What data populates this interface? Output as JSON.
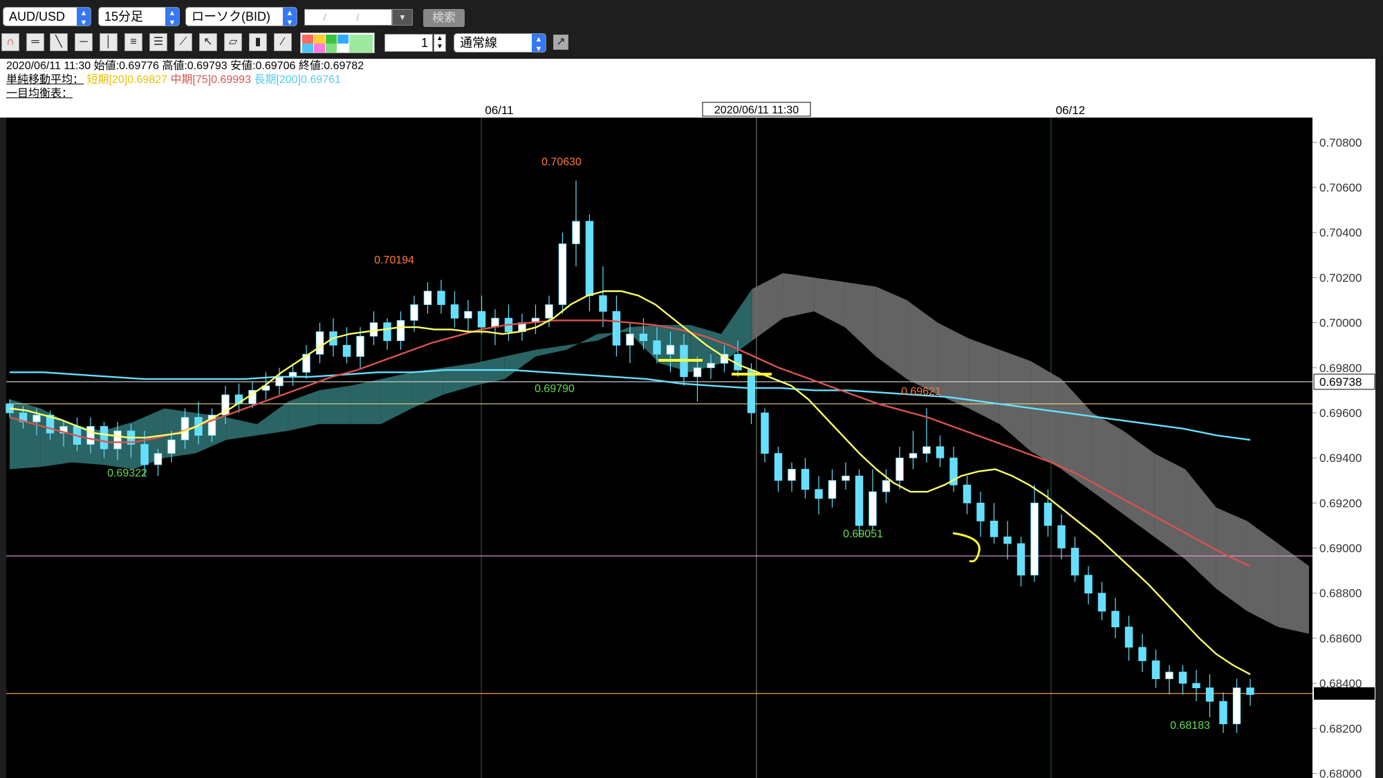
{
  "toolbar": {
    "symbol": "AUD/USD",
    "timeframe": "15分足",
    "chart_type": "ローソク(BID)",
    "date_placeholder": "/ /",
    "search_label": "検索",
    "line_width": "1",
    "line_style": "通常線",
    "palette_colors": [
      "#ff6b5e",
      "#ffcc33",
      "#3ec43e",
      "#33aaff",
      "#4dc4ff",
      "#ff7adf",
      "#7ee07e",
      "#ffffff"
    ],
    "tool_icons": [
      "magnet-icon",
      "horizontal-ray-icon",
      "trend-line-icon",
      "horizontal-line-icon",
      "vertical-line-icon",
      "grid-lines-icon",
      "fibonacci-icon",
      "fan-icon",
      "cursor-icon",
      "eraser-icon",
      "trash-icon",
      "settings-line-icon"
    ]
  },
  "info": {
    "ohlc": "2020/06/11 11:30 始値:0.69776 高値:0.69793 安値:0.69706 終値:0.69782",
    "sma_label": "単純移動平均：",
    "sma_short": "短期[20]0.69827",
    "sma_mid": "中期[75]0.69993",
    "sma_long": "長期[200]0.69761",
    "ichimoku_label": "一目均衡表："
  },
  "colors": {
    "background": "#000000",
    "sma_short": "#ffff66",
    "sma_mid": "#d9534f",
    "sma_long": "#66e0ff",
    "candle": "#66dfff",
    "cloud_bull": "#2f6f6f",
    "cloud_bear": "#6e6e6e",
    "high_label": "#ff7a33",
    "low_label": "#66dd55"
  },
  "chart_data": {
    "type": "line",
    "instrument": "AUD/USD",
    "timeframe": "15分足",
    "y_ticks": [
      "0.70800",
      "0.70600",
      "0.70400",
      "0.70200",
      "0.70000",
      "0.69800",
      "0.69600",
      "0.69400",
      "0.69200",
      "0.69000",
      "0.68800",
      "0.68600",
      "0.68400",
      "0.68200",
      "0.68000"
    ],
    "ylim": [
      0.6798,
      0.7091
    ],
    "x_labels": [
      "06/11",
      "2020/06/11 11:30",
      "06/12"
    ],
    "current_price": "0.69738",
    "annotations": [
      {
        "text": "0.70630",
        "kind": "high"
      },
      {
        "text": "0.70194",
        "kind": "high"
      },
      {
        "text": "0.69621",
        "kind": "high"
      },
      {
        "text": "0.69322",
        "kind": "low"
      },
      {
        "text": "0.69790",
        "kind": "low"
      },
      {
        "text": "0.69051",
        "kind": "low"
      },
      {
        "text": "0.68183",
        "kind": "low"
      }
    ],
    "horizontal_levels": [
      {
        "value": 0.69738,
        "color": "#cccccc"
      },
      {
        "value": 0.6964,
        "color": "#e6d98a"
      },
      {
        "value": 0.68965,
        "color": "#e8a0e0"
      },
      {
        "value": 0.68355,
        "color": "#ff9933"
      }
    ],
    "candles": [
      [
        0.6964,
        0.6966,
        0.6958,
        0.696
      ],
      [
        0.696,
        0.6963,
        0.6953,
        0.6956
      ],
      [
        0.6956,
        0.6962,
        0.695,
        0.6959
      ],
      [
        0.6959,
        0.6961,
        0.6948,
        0.6951
      ],
      [
        0.6951,
        0.6957,
        0.6945,
        0.6954
      ],
      [
        0.6954,
        0.6958,
        0.6943,
        0.6946
      ],
      [
        0.6946,
        0.6958,
        0.6942,
        0.6954
      ],
      [
        0.6954,
        0.6956,
        0.694,
        0.6944
      ],
      [
        0.6944,
        0.6956,
        0.6939,
        0.6952
      ],
      [
        0.6952,
        0.6955,
        0.694,
        0.6946
      ],
      [
        0.6946,
        0.6952,
        0.6932,
        0.6937
      ],
      [
        0.6937,
        0.6944,
        0.6932,
        0.6942
      ],
      [
        0.6942,
        0.6952,
        0.6938,
        0.6948
      ],
      [
        0.6948,
        0.6962,
        0.6944,
        0.6958
      ],
      [
        0.6958,
        0.6965,
        0.6946,
        0.695
      ],
      [
        0.695,
        0.6962,
        0.6947,
        0.6959
      ],
      [
        0.6959,
        0.6972,
        0.6955,
        0.6968
      ],
      [
        0.6968,
        0.6973,
        0.696,
        0.6964
      ],
      [
        0.6964,
        0.6974,
        0.6962,
        0.697
      ],
      [
        0.697,
        0.6978,
        0.6966,
        0.6972
      ],
      [
        0.6972,
        0.698,
        0.6968,
        0.6976
      ],
      [
        0.6976,
        0.6982,
        0.6972,
        0.6978
      ],
      [
        0.6978,
        0.699,
        0.6975,
        0.6986
      ],
      [
        0.6986,
        0.7,
        0.6982,
        0.6996
      ],
      [
        0.6996,
        0.7002,
        0.6985,
        0.699
      ],
      [
        0.699,
        0.6998,
        0.6982,
        0.6985
      ],
      [
        0.6985,
        0.6998,
        0.698,
        0.6994
      ],
      [
        0.6994,
        0.7005,
        0.699,
        0.7
      ],
      [
        0.7,
        0.7002,
        0.6988,
        0.6992
      ],
      [
        0.6992,
        0.7005,
        0.6988,
        0.7001
      ],
      [
        0.7001,
        0.7012,
        0.6996,
        0.7008
      ],
      [
        0.7008,
        0.7018,
        0.7004,
        0.7014
      ],
      [
        0.7014,
        0.7019,
        0.7004,
        0.7008
      ],
      [
        0.7008,
        0.7014,
        0.6998,
        0.7002
      ],
      [
        0.7002,
        0.701,
        0.6996,
        0.7005
      ],
      [
        0.7005,
        0.7012,
        0.6995,
        0.6998
      ],
      [
        0.6998,
        0.7006,
        0.699,
        0.7002
      ],
      [
        0.7002,
        0.7008,
        0.6992,
        0.6996
      ],
      [
        0.6996,
        0.7004,
        0.6992,
        0.7
      ],
      [
        0.7,
        0.7008,
        0.6995,
        0.7002
      ],
      [
        0.7002,
        0.7012,
        0.6998,
        0.7008
      ],
      [
        0.7008,
        0.704,
        0.7004,
        0.7035
      ],
      [
        0.7035,
        0.7063,
        0.7025,
        0.7045
      ],
      [
        0.7045,
        0.7048,
        0.7005,
        0.7012
      ],
      [
        0.7012,
        0.7025,
        0.6998,
        0.7005
      ],
      [
        0.7005,
        0.7012,
        0.6985,
        0.699
      ],
      [
        0.699,
        0.7,
        0.6982,
        0.6995
      ],
      [
        0.6995,
        0.7002,
        0.6988,
        0.6992
      ],
      [
        0.6992,
        0.6998,
        0.6982,
        0.6986
      ],
      [
        0.6986,
        0.6996,
        0.6978,
        0.699
      ],
      [
        0.699,
        0.6995,
        0.6972,
        0.6976
      ],
      [
        0.6976,
        0.6985,
        0.6965,
        0.698
      ],
      [
        0.698,
        0.6986,
        0.6975,
        0.6982
      ],
      [
        0.6982,
        0.699,
        0.6978,
        0.6986
      ],
      [
        0.6986,
        0.6992,
        0.6976,
        0.6979
      ],
      [
        0.6979,
        0.6982,
        0.6955,
        0.696
      ],
      [
        0.696,
        0.6962,
        0.6938,
        0.6942
      ],
      [
        0.6942,
        0.6945,
        0.6925,
        0.693
      ],
      [
        0.693,
        0.6938,
        0.6925,
        0.6935
      ],
      [
        0.6935,
        0.694,
        0.6922,
        0.6926
      ],
      [
        0.6926,
        0.6932,
        0.6915,
        0.6922
      ],
      [
        0.6922,
        0.6935,
        0.6918,
        0.693
      ],
      [
        0.693,
        0.6938,
        0.6926,
        0.6932
      ],
      [
        0.6932,
        0.6935,
        0.6905,
        0.691
      ],
      [
        0.691,
        0.6935,
        0.6908,
        0.6925
      ],
      [
        0.6925,
        0.6935,
        0.692,
        0.693
      ],
      [
        0.693,
        0.6945,
        0.6926,
        0.694
      ],
      [
        0.694,
        0.6952,
        0.6935,
        0.6942
      ],
      [
        0.6942,
        0.6962,
        0.6938,
        0.6945
      ],
      [
        0.6945,
        0.695,
        0.6936,
        0.694
      ],
      [
        0.694,
        0.6945,
        0.6925,
        0.6928
      ],
      [
        0.6928,
        0.6932,
        0.6915,
        0.692
      ],
      [
        0.692,
        0.6925,
        0.6905,
        0.6912
      ],
      [
        0.6912,
        0.692,
        0.6902,
        0.6905
      ],
      [
        0.6905,
        0.6912,
        0.6895,
        0.6902
      ],
      [
        0.6902,
        0.6905,
        0.6883,
        0.6888
      ],
      [
        0.6888,
        0.6928,
        0.6885,
        0.692
      ],
      [
        0.692,
        0.6926,
        0.6905,
        0.691
      ],
      [
        0.691,
        0.6915,
        0.6895,
        0.69
      ],
      [
        0.69,
        0.6905,
        0.6885,
        0.6888
      ],
      [
        0.6888,
        0.6892,
        0.6875,
        0.688
      ],
      [
        0.688,
        0.6885,
        0.6868,
        0.6872
      ],
      [
        0.6872,
        0.6878,
        0.686,
        0.6865
      ],
      [
        0.6865,
        0.687,
        0.685,
        0.6856
      ],
      [
        0.6856,
        0.6862,
        0.6845,
        0.685
      ],
      [
        0.685,
        0.6855,
        0.6838,
        0.6842
      ],
      [
        0.6842,
        0.6848,
        0.6835,
        0.6845
      ],
      [
        0.6845,
        0.6848,
        0.6835,
        0.684
      ],
      [
        0.684,
        0.6846,
        0.6832,
        0.6838
      ],
      [
        0.6838,
        0.6844,
        0.6825,
        0.6832
      ],
      [
        0.6832,
        0.6836,
        0.6818,
        0.6822
      ],
      [
        0.6822,
        0.6842,
        0.6818,
        0.6838
      ],
      [
        0.6838,
        0.6842,
        0.683,
        0.6835
      ]
    ],
    "series": [
      {
        "name": "短期[20]",
        "values": [
          0.6962,
          0.6961,
          0.6959,
          0.6957,
          0.6954,
          0.6951,
          0.695,
          0.6949,
          0.6949,
          0.695,
          0.6951,
          0.6954,
          0.6958,
          0.6962,
          0.6967,
          0.6972,
          0.6978,
          0.6983,
          0.6988,
          0.6993,
          0.6995,
          0.6996,
          0.6997,
          0.6998,
          0.6998,
          0.6997,
          0.6997,
          0.6996,
          0.6996,
          0.6995,
          0.6996,
          0.6998,
          0.7002,
          0.7008,
          0.7012,
          0.7014,
          0.7014,
          0.7012,
          0.7008,
          0.7002,
          0.6996,
          0.699,
          0.6985,
          0.6981,
          0.6978,
          0.6975,
          0.6972,
          0.6966,
          0.6958,
          0.695,
          0.6942,
          0.6935,
          0.6929,
          0.6925,
          0.6925,
          0.6928,
          0.6932,
          0.6934,
          0.6935,
          0.6932,
          0.6928,
          0.6923,
          0.6917,
          0.6911,
          0.6905,
          0.6898,
          0.6891,
          0.6884,
          0.6876,
          0.6868,
          0.686,
          0.6853,
          0.6848,
          0.6844
        ]
      },
      {
        "name": "中期[75]",
        "values": [
          0.6958,
          0.6955,
          0.6952,
          0.6949,
          0.6947,
          0.6947,
          0.6949,
          0.6952,
          0.6956,
          0.696,
          0.6964,
          0.6968,
          0.6972,
          0.6976,
          0.6979,
          0.6983,
          0.6987,
          0.6991,
          0.6994,
          0.6997,
          0.6999,
          0.7,
          0.7001,
          0.7001,
          0.7001,
          0.7,
          0.6999,
          0.6997,
          0.6994,
          0.699,
          0.6985,
          0.698,
          0.6976,
          0.6972,
          0.6968,
          0.6964,
          0.6961,
          0.6958,
          0.6954,
          0.695,
          0.6946,
          0.6942,
          0.6938,
          0.6933,
          0.6927,
          0.6921,
          0.6915,
          0.6909,
          0.6903,
          0.6897,
          0.6892
        ]
      },
      {
        "name": "長期[200]",
        "values": [
          0.6978,
          0.6978,
          0.6977,
          0.6976,
          0.6975,
          0.6975,
          0.6975,
          0.6975,
          0.6976,
          0.6976,
          0.6977,
          0.6978,
          0.6978,
          0.6979,
          0.6979,
          0.6979,
          0.6978,
          0.6977,
          0.6976,
          0.6975,
          0.6973,
          0.6972,
          0.6971,
          0.6971,
          0.697,
          0.697,
          0.6969,
          0.6968,
          0.6967,
          0.6965,
          0.6963,
          0.6961,
          0.6959,
          0.6957,
          0.6955,
          0.6953,
          0.695,
          0.6948
        ]
      }
    ],
    "cloud": {
      "upper": [
        0.6966,
        0.6962,
        0.6955,
        0.6952,
        0.6956,
        0.6962,
        0.696,
        0.6958,
        0.6955,
        0.6965,
        0.697,
        0.6972,
        0.6975,
        0.6978,
        0.698,
        0.6982,
        0.6985,
        0.6988,
        0.699,
        0.6992,
        0.6998,
        0.6999,
        0.6999,
        0.6995,
        0.7015,
        0.7022,
        0.702,
        0.7018,
        0.7016,
        0.701,
        0.7,
        0.6993,
        0.6988,
        0.6983,
        0.6975,
        0.696,
        0.6952,
        0.6942,
        0.6935,
        0.6918,
        0.6912,
        0.6902,
        0.6892
      ],
      "lower": [
        0.6935,
        0.6936,
        0.6938,
        0.6937,
        0.6935,
        0.694,
        0.6942,
        0.6948,
        0.695,
        0.6952,
        0.6955,
        0.6955,
        0.6955,
        0.6962,
        0.6968,
        0.6972,
        0.6975,
        0.6985,
        0.6988,
        0.6995,
        0.6996,
        0.6982,
        0.6978,
        0.6982,
        0.6992,
        0.7002,
        0.7005,
        0.6998,
        0.6985,
        0.6975,
        0.6968,
        0.6962,
        0.6955,
        0.6943,
        0.6935,
        0.6925,
        0.6915,
        0.6905,
        0.6895,
        0.6882,
        0.6872,
        0.6865,
        0.6862
      ]
    }
  }
}
